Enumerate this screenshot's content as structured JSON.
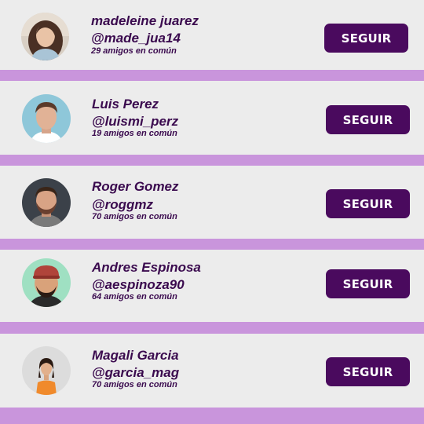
{
  "suggestions": [
    {
      "name": "madeleine juarez",
      "handle": "@made_jua14",
      "mutual": "29 amigos en común",
      "button": "SEGUIR"
    },
    {
      "name": "Luis Perez",
      "handle": "@luismi_perz",
      "mutual": "19 amigos en común",
      "button": "SEGUIR"
    },
    {
      "name": "Roger Gomez",
      "handle": "@roggmz",
      "mutual": "70 amigos en común",
      "button": "SEGUIR"
    },
    {
      "name": "Andres Espinosa",
      "handle": "@aespinoza90",
      "mutual": "64 amigos en común",
      "button": "SEGUIR"
    },
    {
      "name": "Magali Garcia",
      "handle": "@garcia_mag",
      "mutual": "70 amigos en común",
      "button": "SEGUIR"
    }
  ],
  "colors": {
    "background_stripe": "#c995dc",
    "card": "#ececec",
    "text": "#3a0a4e",
    "button": "#4a0a5e",
    "button_text": "#ffffff"
  }
}
